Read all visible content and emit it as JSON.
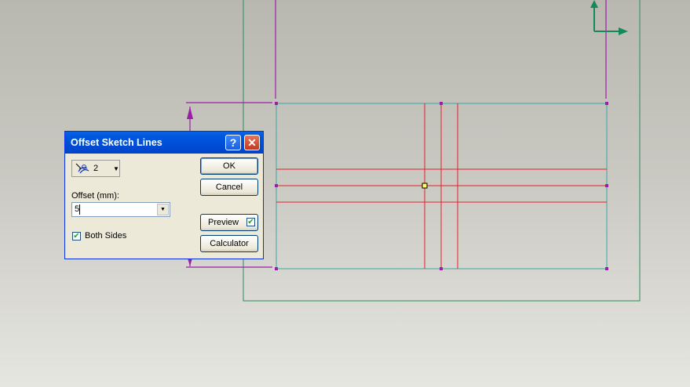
{
  "dialog": {
    "title": "Offset Sketch Lines",
    "help_label": "?",
    "close_label": "✕",
    "sides_value": "2",
    "offset_label": "Offset (mm):",
    "offset_value": "5",
    "both_sides_label": "Both Sides",
    "both_sides_checked": true,
    "ok_label": "OK",
    "cancel_label": "Cancel",
    "preview_label": "Preview",
    "preview_checked": true,
    "calculator_label": "Calculator"
  },
  "colors": {
    "frame_line": "#2f8a5a",
    "sketch_rect": "#37a8a8",
    "sketch_lines": "#e3202a",
    "dimension": "#9a1fa8",
    "axis_arrow": "#138a5a",
    "vertex": "#9a1fa8",
    "selected_point": "#ffff66"
  },
  "icons": {
    "offset_tool": "offset-sketch-icon",
    "dropdown": "chevron-down-icon",
    "check": "check-icon"
  }
}
